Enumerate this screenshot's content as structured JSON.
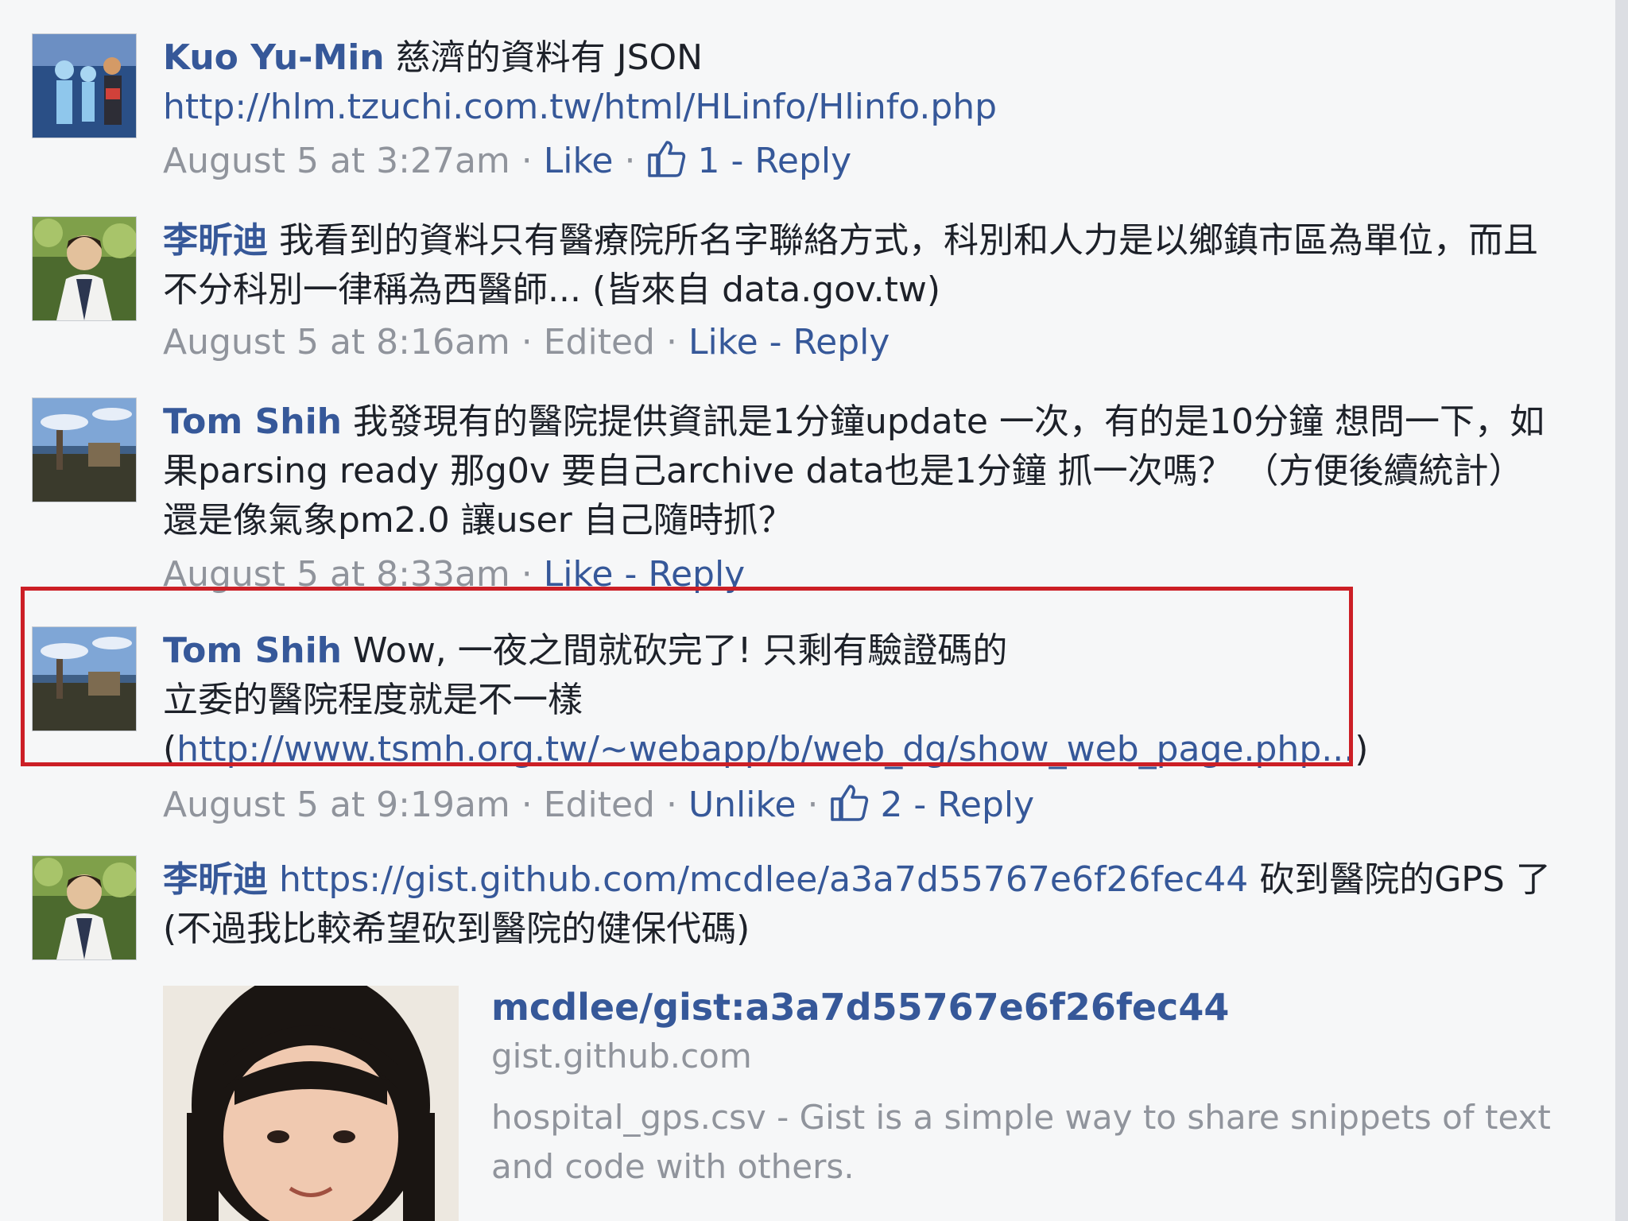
{
  "comments": [
    {
      "author": "Kuo Yu-Min",
      "text": " 慈濟的資料有 JSON",
      "link": "http://hlm.tzuchi.com.tw/html/HLinfo/Hlinfo.php",
      "time": "August 5 at 3:27am",
      "sep": " · ",
      "like": "Like",
      "likes_count": "1",
      "reply": "Reply"
    },
    {
      "author": "李昕迪",
      "text": " 我看到的資料只有醫療院所名字聯絡方式，科別和人力是以鄉鎮市區為單位，而且不分科別一律稱為西醫師... (皆來自 data.gov.tw)",
      "time": "August 5 at 8:16am",
      "edited": "Edited",
      "like": "Like",
      "reply": "Reply"
    },
    {
      "author": "Tom Shih",
      "text": " 我發現有的醫院提供資訊是1分鐘update 一次，有的是10分鐘 想問一下，如果parsing ready 那g0v 要自己archive data也是1分鐘 抓一次嗎？ （方便後續統計） 還是像氣象pm2.0 讓user 自己隨時抓？",
      "time": "August 5 at 8:33am",
      "like": "Like",
      "reply": "Reply"
    },
    {
      "author": "Tom Shih",
      "line1": " Wow, 一夜之間就砍完了! 只剩有驗證碼的",
      "line2": "立委的醫院程度就是不一樣",
      "paren_open": "(",
      "link": "http://www.tsmh.org.tw/~webapp/b/web_dg/show_web_page.php...",
      "paren_close": ")",
      "time": "August 5 at 9:19am",
      "edited": "Edited",
      "like": "Unlike",
      "likes_count": "2",
      "reply": "Reply"
    },
    {
      "author": "李昕迪",
      "link": "https://gist.github.com/mcdlee/a3a7d55767e6f26fec44",
      "text": " 砍到醫院的GPS 了 (不過我比較希望砍到醫院的健保代碼)",
      "preview": {
        "title": "mcdlee/gist:a3a7d55767e6f26fec44",
        "domain": "gist.github.com",
        "description": "hospital_gps.csv - Gist is a simple way to share snippets of text and code with others."
      }
    }
  ],
  "colors": {
    "link": "#365899",
    "meta": "#90949c",
    "text": "#1d2129",
    "highlight": "#cc1f26"
  }
}
